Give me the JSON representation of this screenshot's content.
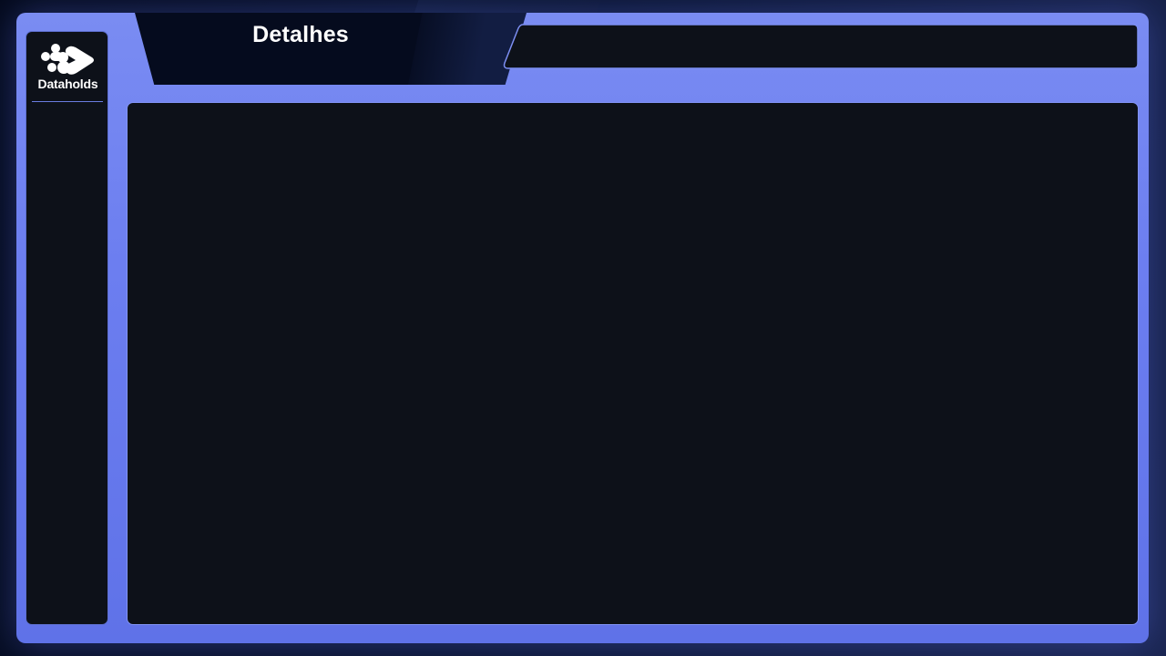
{
  "header": {
    "title": "Detalhes"
  },
  "brand": {
    "name": "Dataholds",
    "icon": "dataholds-logo-icon"
  },
  "colors": {
    "frame_accent": "#6c7ef0",
    "panel_bg": "#0d1119",
    "page_bg": "#050b1e",
    "text": "#ffffff"
  }
}
